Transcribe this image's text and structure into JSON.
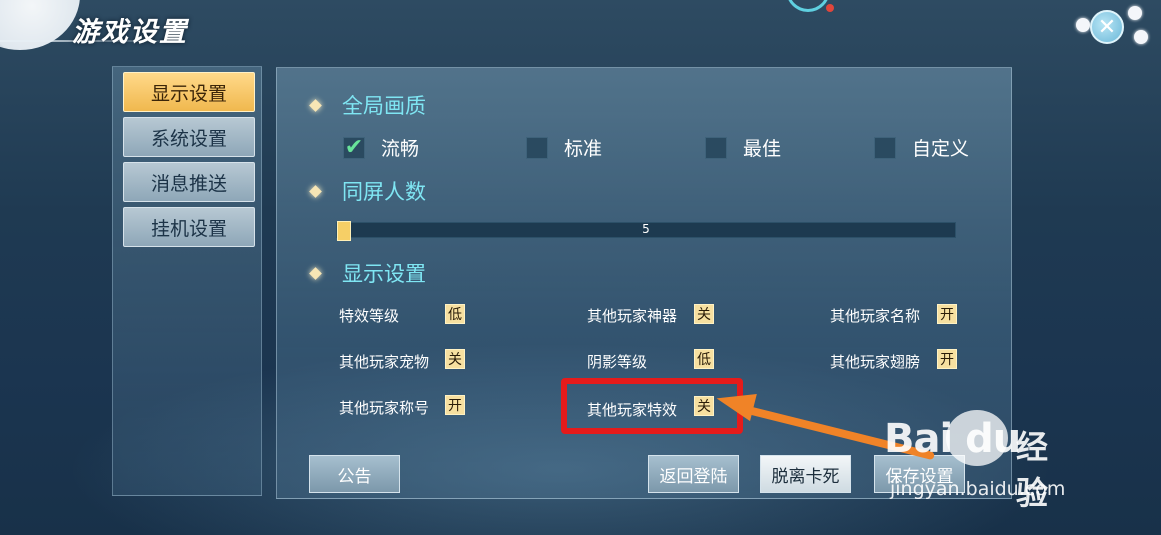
{
  "header": {
    "title": "游戏设置",
    "close_symbol": "✕"
  },
  "sidebar": {
    "items": [
      {
        "label": "显示设置",
        "active": true
      },
      {
        "label": "系统设置",
        "active": false
      },
      {
        "label": "消息推送",
        "active": false
      },
      {
        "label": "挂机设置",
        "active": false
      }
    ]
  },
  "quality": {
    "heading": "全局画质",
    "options": [
      {
        "label": "流畅",
        "checked": true
      },
      {
        "label": "标准",
        "checked": false
      },
      {
        "label": "最佳",
        "checked": false
      },
      {
        "label": "自定义",
        "checked": false
      }
    ],
    "check_symbol": "✔"
  },
  "same_screen": {
    "heading": "同屏人数",
    "value": "5"
  },
  "display": {
    "heading": "显示设置",
    "options": [
      {
        "label": "特效等级",
        "toggle": "低"
      },
      {
        "label": "其他玩家神器",
        "toggle": "关"
      },
      {
        "label": "其他玩家名称",
        "toggle": "开"
      },
      {
        "label": "其他玩家宠物",
        "toggle": "关"
      },
      {
        "label": "阴影等级",
        "toggle": "低"
      },
      {
        "label": "其他玩家翅膀",
        "toggle": "开"
      },
      {
        "label": "其他玩家称号",
        "toggle": "开"
      },
      {
        "label": "其他玩家特效",
        "toggle": "关"
      }
    ]
  },
  "buttons": {
    "announcement": "公告",
    "return_login": "返回登陆",
    "unstuck": "脱离卡死",
    "save": "保存设置"
  },
  "watermark": {
    "logo": "Bai du",
    "jingyan": "经验",
    "url": "jingyan.baidu.com"
  },
  "colors": {
    "accent": "#7fe6f3",
    "highlight": "#e51b1b",
    "arrow": "#f08327",
    "active_tab": "#f0b84e"
  }
}
